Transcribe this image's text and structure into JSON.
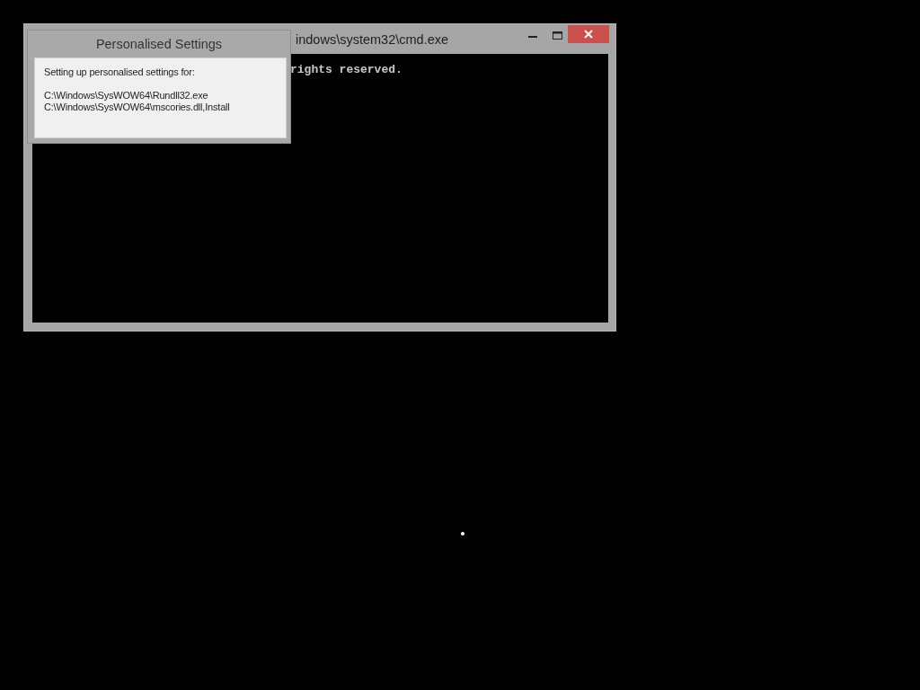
{
  "console_window": {
    "title": "indows\\system32\\cmd.exe",
    "lines": [
      "rights reserved."
    ]
  },
  "dialog": {
    "title": "Personalised Settings",
    "message": "Setting up personalised settings for:",
    "paths": [
      "C:\\Windows\\SysWOW64\\Rundll32.exe",
      "C:\\Windows\\SysWOW64\\mscories.dll,Install"
    ]
  }
}
